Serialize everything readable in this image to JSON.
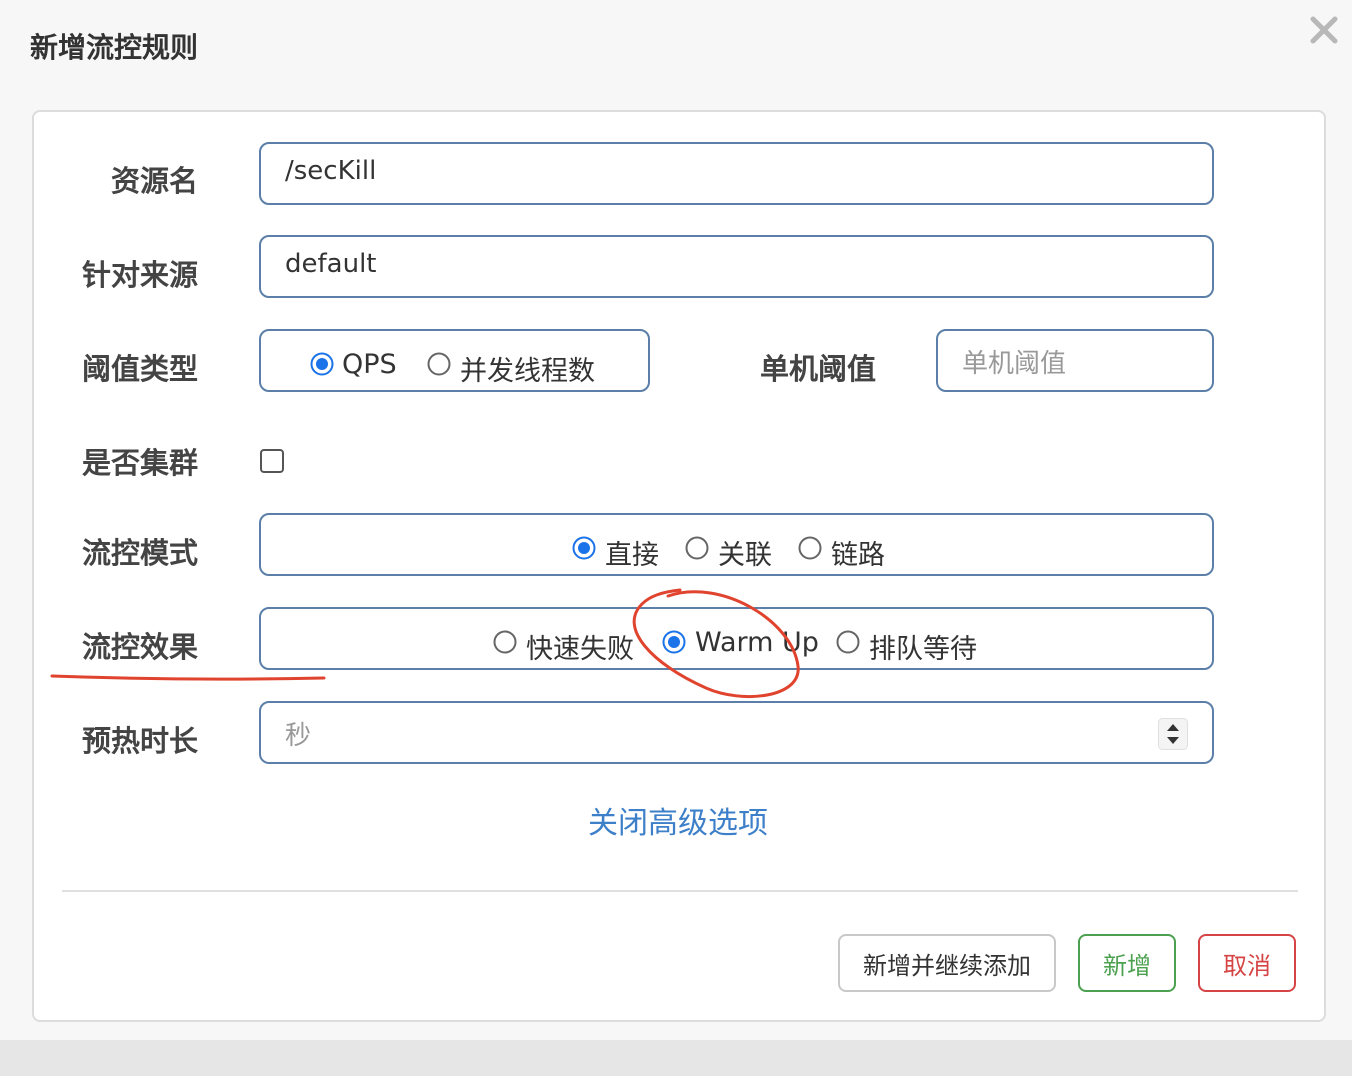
{
  "dialog": {
    "title": "新增流控规则",
    "close_icon": "close-icon"
  },
  "form": {
    "resource": {
      "label": "资源名",
      "value": "/secKill"
    },
    "limit_app": {
      "label": "针对来源",
      "value": "default"
    },
    "threshold_type": {
      "label": "阈值类型",
      "options": [
        "QPS",
        "并发线程数"
      ],
      "selected": "QPS"
    },
    "single_threshold": {
      "label": "单机阈值",
      "placeholder": "单机阈值",
      "value": ""
    },
    "cluster": {
      "label": "是否集群",
      "checked": false
    },
    "mode": {
      "label": "流控模式",
      "options": [
        "直接",
        "关联",
        "链路"
      ],
      "selected": "直接"
    },
    "effect": {
      "label": "流控效果",
      "options": [
        "快速失败",
        "Warm Up",
        "排队等待"
      ],
      "selected": "Warm Up"
    },
    "warmup": {
      "label": "预热时长",
      "placeholder": "秒",
      "value": ""
    },
    "advanced_toggle": "关闭高级选项"
  },
  "buttons": {
    "add_continue": "新增并继续添加",
    "add": "新增",
    "cancel": "取消"
  },
  "colors": {
    "radio_selected": "#1a73e8",
    "link": "#3d7fc9",
    "add_green": "#4ba14f",
    "cancel_red": "#d64545",
    "annotation_red": "#e0442e",
    "input_border": "#5b7fa8"
  }
}
